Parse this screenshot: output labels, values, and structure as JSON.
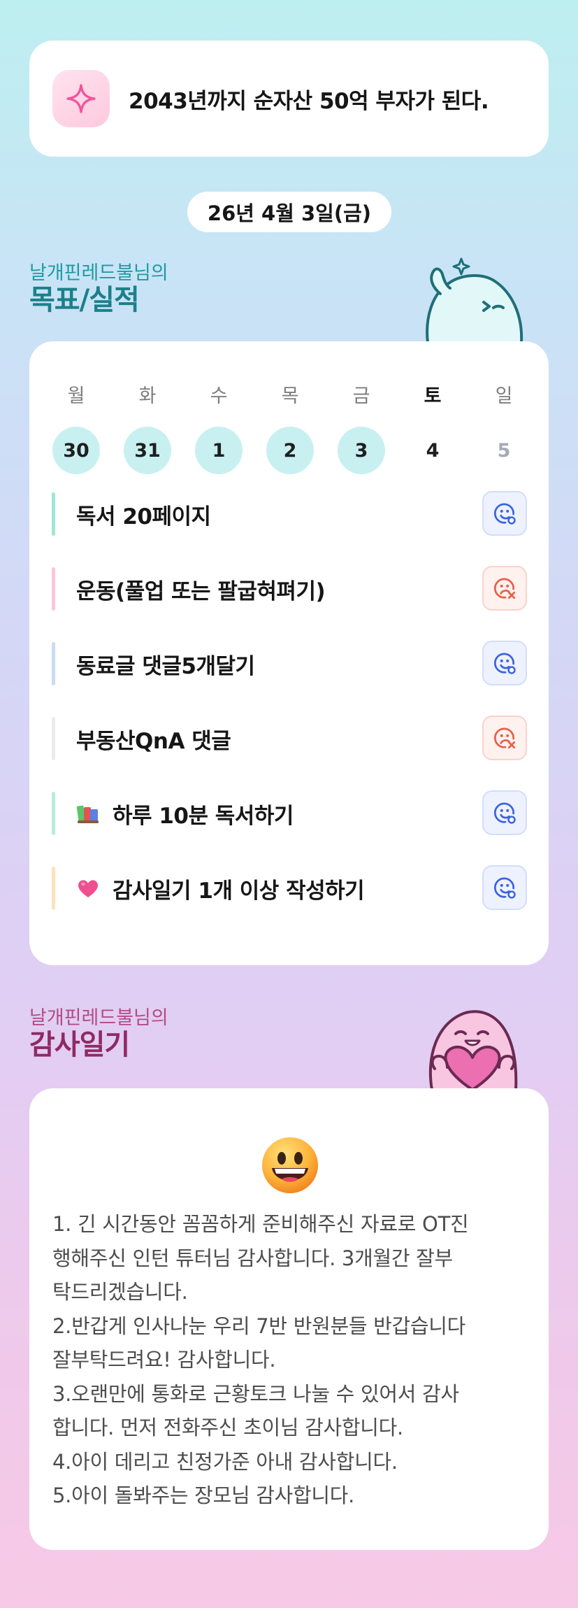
{
  "goal": {
    "text": "2043년까지 순자산 50억 부자가 된다.",
    "icon": "sparkle-icon"
  },
  "date": "26년 4월 3일(금)",
  "goals_section": {
    "owner": "날개핀레드불님의",
    "title": "목표/실적"
  },
  "week": [
    {
      "day": "월",
      "date": "30",
      "state": "done"
    },
    {
      "day": "화",
      "date": "31",
      "state": "done"
    },
    {
      "day": "수",
      "date": "1",
      "state": "done"
    },
    {
      "day": "목",
      "date": "2",
      "state": "done"
    },
    {
      "day": "금",
      "date": "3",
      "state": "done"
    },
    {
      "day": "토",
      "date": "4",
      "state": "today"
    },
    {
      "day": "일",
      "date": "5",
      "state": "future"
    }
  ],
  "tasks": [
    {
      "label": "독서 20페이지",
      "status": "success",
      "bar_color": "#9fe6d6",
      "emoji": ""
    },
    {
      "label": "운동(풀업 또는 팔굽혀펴기)",
      "status": "fail",
      "bar_color": "#f8c7dc",
      "emoji": ""
    },
    {
      "label": "동료글 댓글5개달기",
      "status": "success",
      "bar_color": "#c9dcf7",
      "emoji": ""
    },
    {
      "label": "부동산QnA 댓글",
      "status": "fail",
      "bar_color": "#ececf0",
      "emoji": ""
    },
    {
      "label": "하루 10분 독서하기",
      "status": "success",
      "bar_color": "#b8ecd9",
      "emoji": "books-icon"
    },
    {
      "label": "감사일기 1개 이상 작성하기",
      "status": "success",
      "bar_color": "#fbe3be",
      "emoji": "heart-icon"
    }
  ],
  "status_icons": {
    "success": "smile-check-icon",
    "fail": "frown-x-icon"
  },
  "diary_section": {
    "owner": "날개핀레드불님의",
    "title": "감사일기"
  },
  "diary": {
    "emoji": "grinning-face-icon",
    "lines": [
      "1. 긴 시간동안 꼼꼼하게 준비해주신 자료로 OT진",
      "행해주신 인턴 튜터님 감사합니다. 3개월간 잘부",
      "탁드리겠습니다.",
      "2.반갑게 인사나눈 우리 7반 반원분들 반갑습니다",
      "잘부탁드려요! 감사합니다.",
      "3.오랜만에 통화로 근황토크 나눌 수 있어서 감사",
      "합니다. 먼저 전화주신 초이님 감사합니다.",
      "4.아이 데리고 친정가준 아내 감사합니다.",
      "5.아이 돌봐주는 장모님 감사합니다."
    ]
  },
  "colors": {
    "accent_teal": "#1b8089",
    "accent_pink": "#8f2a63",
    "done_day_bg": "#c8f0f1",
    "success_icon": "#3b64e0",
    "fail_icon": "#e5604a"
  }
}
